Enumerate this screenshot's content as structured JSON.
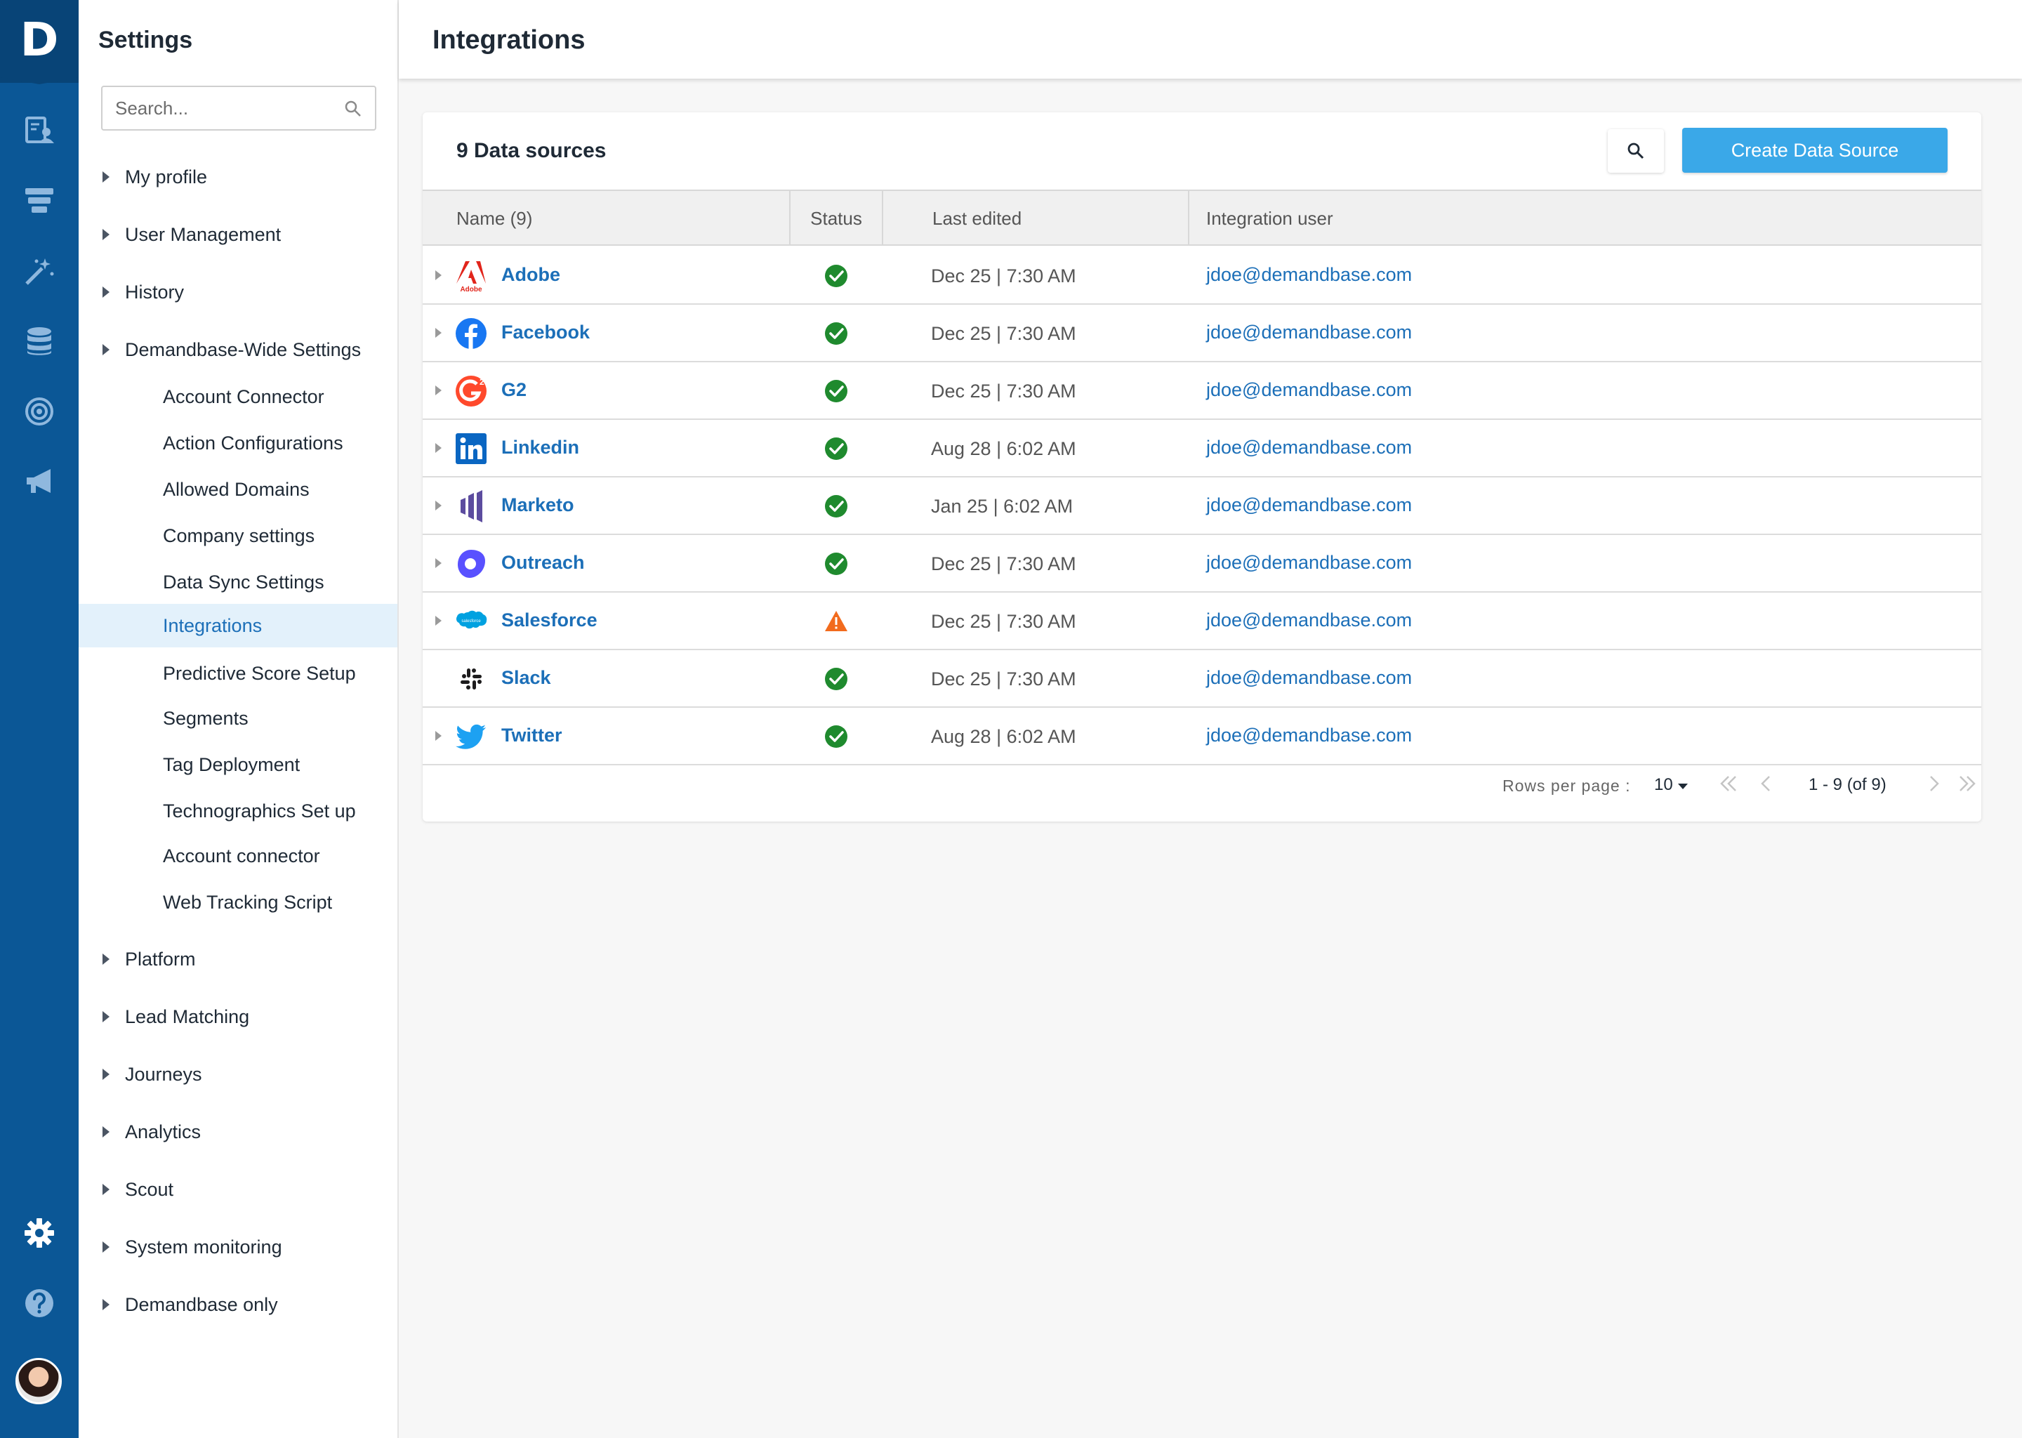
{
  "rail": {
    "logo_letter": "D",
    "icons": [
      "account-lists-icon",
      "funnel-icon",
      "magic-wand-icon",
      "database-icon",
      "target-icon",
      "megaphone-icon",
      "gear-icon",
      "help-icon"
    ]
  },
  "settings": {
    "title": "Settings",
    "search_placeholder": "Search...",
    "top_items": [
      "My profile",
      "User Management",
      "History",
      "Demandbase-Wide Settings"
    ],
    "sub_items": [
      "Account Connector",
      "Action Configurations",
      "Allowed Domains",
      "Company settings",
      "Data Sync Settings",
      "Integrations",
      "Predictive Score Setup",
      "Segments",
      "Tag Deployment",
      "Technographics Set up",
      "Account connector",
      "Web Tracking Script"
    ],
    "active_sub": "Integrations",
    "bottom_items": [
      "Platform",
      "Lead Matching",
      "Journeys",
      "Analytics",
      "Scout",
      "System monitoring",
      "Demandbase only"
    ]
  },
  "page": {
    "title": "Integrations"
  },
  "card": {
    "title": "9 Data sources",
    "create_button": "Create Data Source",
    "columns": [
      "Name (9)",
      "Status",
      "Last edited",
      "Integration user"
    ],
    "rows": [
      {
        "name": "Adobe",
        "logo": "adobe-logo-icon",
        "logo_text": "Adobe",
        "status": "ok",
        "edited": "Dec 25 | 7:30 AM",
        "user": "jdoe@demandbase.com",
        "expandable": true
      },
      {
        "name": "Facebook",
        "logo": "facebook-logo-icon",
        "status": "ok",
        "edited": "Dec 25 | 7:30 AM",
        "user": "jdoe@demandbase.com",
        "expandable": true
      },
      {
        "name": "G2",
        "logo": "g2-logo-icon",
        "status": "ok",
        "edited": "Dec 25 | 7:30 AM",
        "user": "jdoe@demandbase.com",
        "expandable": true
      },
      {
        "name": "Linkedin",
        "logo": "linkedin-logo-icon",
        "status": "ok",
        "edited": "Aug 28 | 6:02 AM",
        "user": "jdoe@demandbase.com",
        "expandable": true
      },
      {
        "name": "Marketo",
        "logo": "marketo-logo-icon",
        "status": "ok",
        "edited": "Jan 25 | 6:02 AM",
        "user": "jdoe@demandbase.com",
        "expandable": true
      },
      {
        "name": "Outreach",
        "logo": "outreach-logo-icon",
        "status": "ok",
        "edited": "Dec 25 | 7:30 AM",
        "user": "jdoe@demandbase.com",
        "expandable": true
      },
      {
        "name": "Salesforce",
        "logo": "salesforce-logo-icon",
        "logo_text": "salesforce",
        "status": "warning",
        "edited": "Dec 25 | 7:30 AM",
        "user": "jdoe@demandbase.com",
        "expandable": true
      },
      {
        "name": "Slack",
        "logo": "slack-logo-icon",
        "status": "ok",
        "edited": "Dec 25 | 7:30 AM",
        "user": "jdoe@demandbase.com",
        "expandable": false
      },
      {
        "name": "Twitter",
        "logo": "twitter-logo-icon",
        "status": "ok",
        "edited": "Aug 28 | 6:02 AM",
        "user": "jdoe@demandbase.com",
        "expandable": true
      }
    ],
    "pager": {
      "rows_per_page_label": "Rows per page :",
      "rows_per_page": "10",
      "range": "1 - 9 (of 9)"
    }
  },
  "colors": {
    "rail": "#0b5796",
    "accent": "#3aa8e8",
    "link": "#1c6fb8",
    "ok": "#1f8a2e",
    "warning": "#f26b1d",
    "active_bg": "#e3f1fb"
  }
}
